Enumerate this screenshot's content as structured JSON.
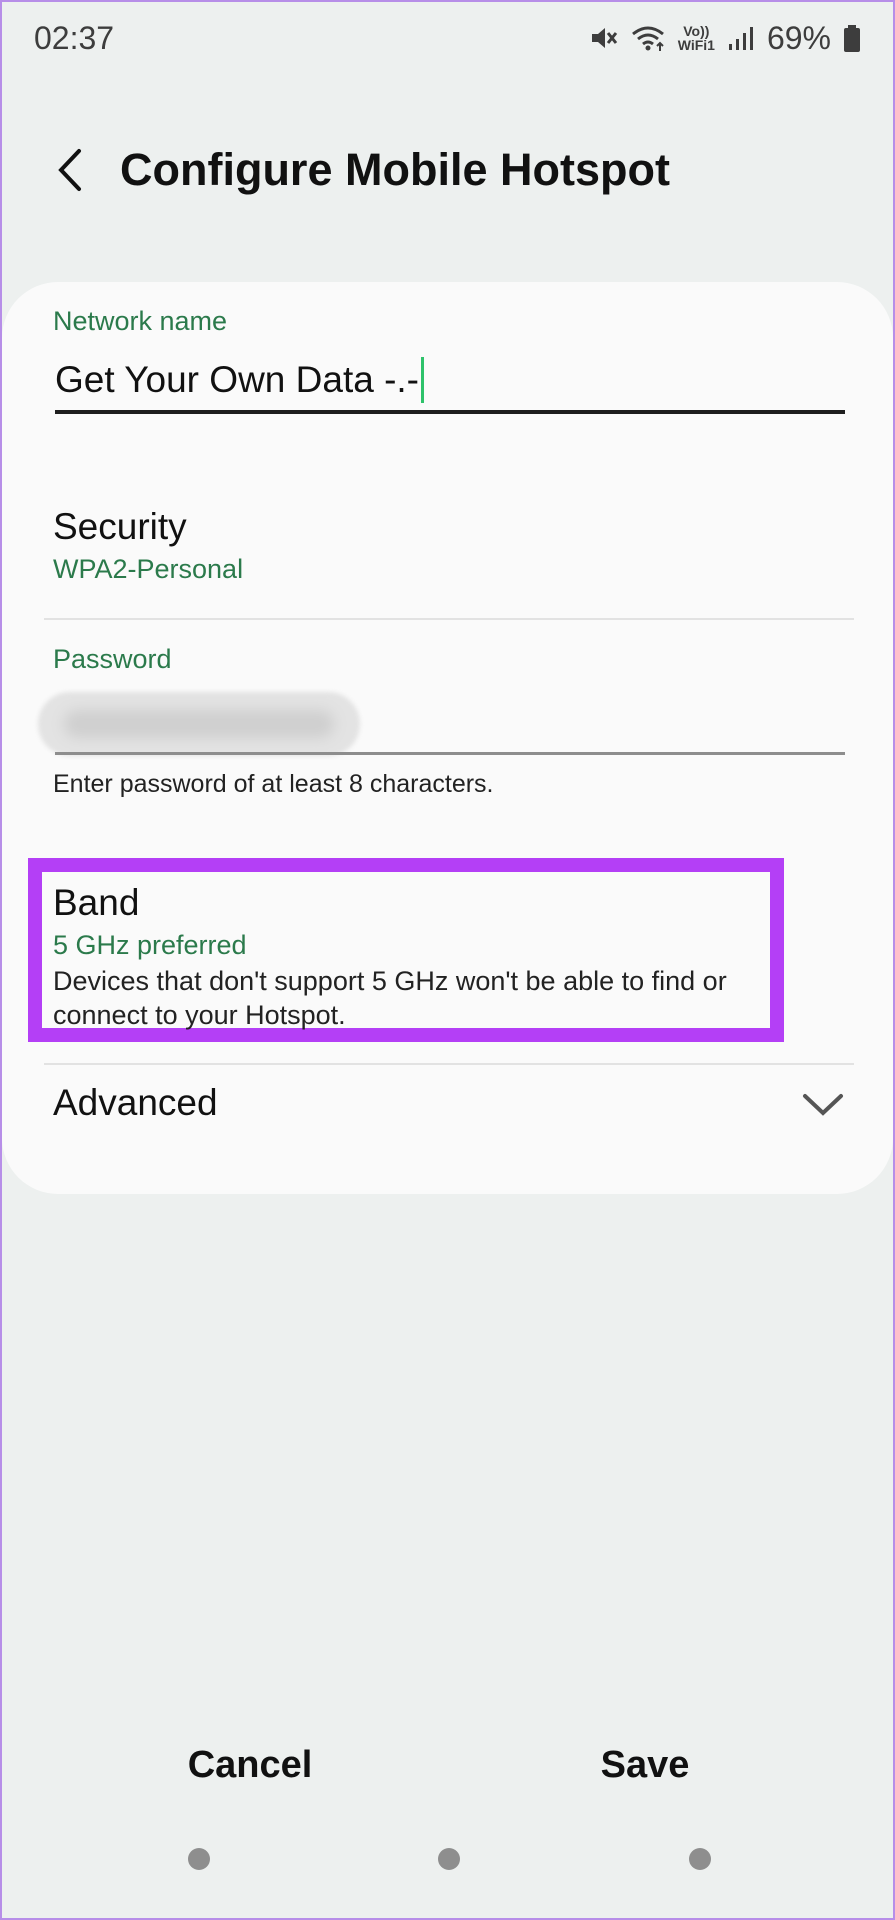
{
  "status_bar": {
    "time": "02:37",
    "volte_top": "Vo))",
    "volte_bottom": "WiFi1",
    "battery": "69%",
    "icons": [
      "mute-icon",
      "wifi-icon",
      "vowifi-icon",
      "signal-icon",
      "battery-icon"
    ]
  },
  "header": {
    "title": "Configure Mobile Hotspot"
  },
  "network": {
    "label": "Network name",
    "value": "Get Your Own Data -.-"
  },
  "security": {
    "title": "Security",
    "value": "WPA2-Personal"
  },
  "password": {
    "label": "Password",
    "helper": "Enter password of at least 8 characters."
  },
  "band": {
    "title": "Band",
    "value": "5 GHz preferred",
    "description": "Devices that don't support 5 GHz won't be able to find or connect to your Hotspot."
  },
  "advanced": {
    "label": "Advanced"
  },
  "buttons": {
    "cancel": "Cancel",
    "save": "Save"
  },
  "colors": {
    "accent_green": "#2b7a4b",
    "highlight_purple": "#b43ff6",
    "cursor_green": "#2ec26a",
    "background": "#edf0ef",
    "card": "#fafafa"
  }
}
